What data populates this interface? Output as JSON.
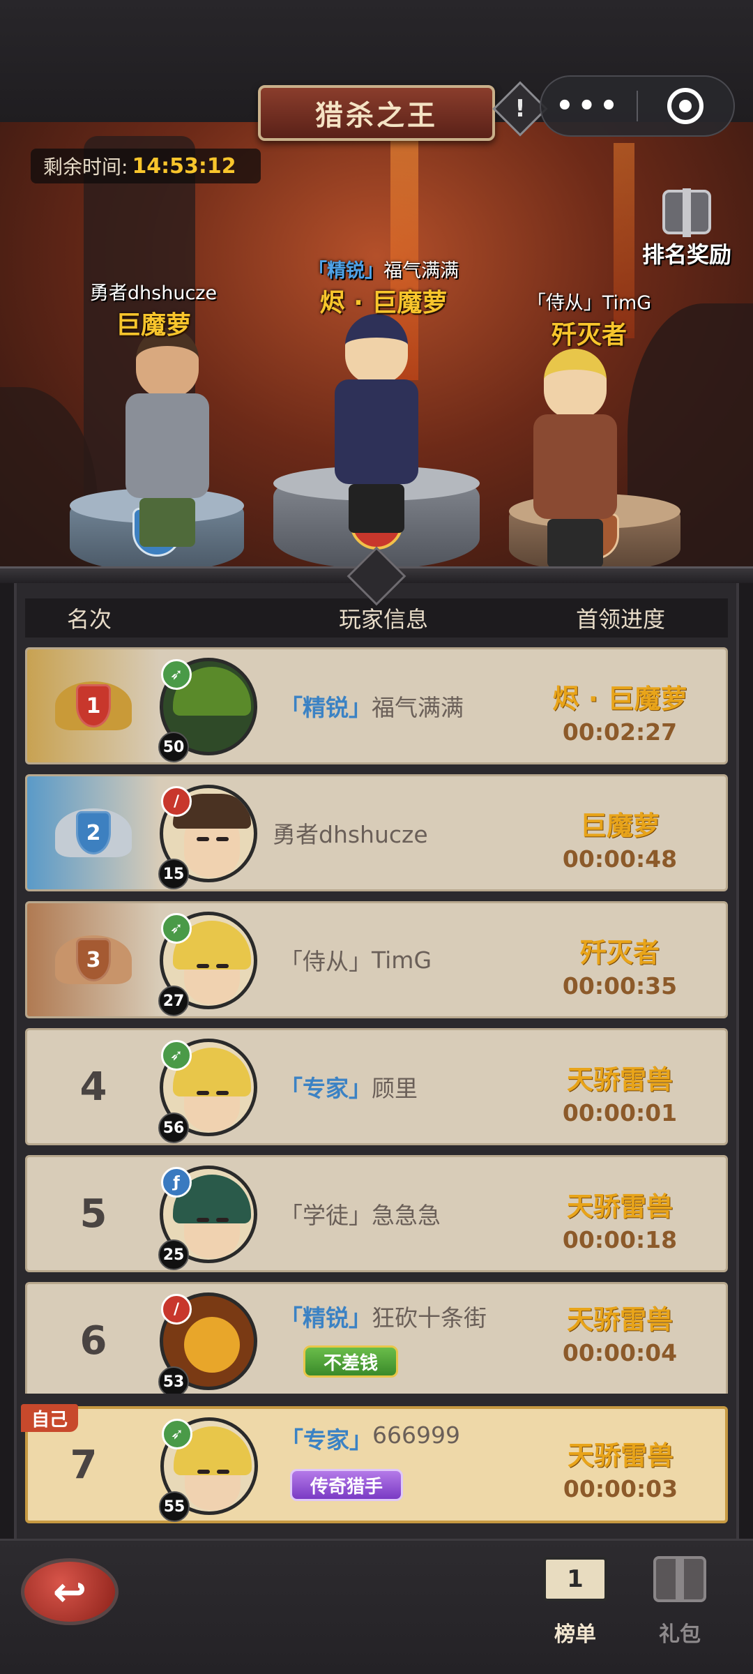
{
  "header": {
    "title": "猎杀之王",
    "info_icon": "exclamation-diamond-icon",
    "menu_dots": "•••"
  },
  "event": {
    "timer_label": "剩余时间:",
    "timer_value": "14:53:12",
    "reward_label": "排名奖励"
  },
  "podium": [
    {
      "rank": "1",
      "tag": "「精锐」",
      "player": "福气满满",
      "boss": "烬 · 巨魔萝"
    },
    {
      "rank": "2",
      "tag": "",
      "player": "勇者dhshucze",
      "boss": "巨魔萝"
    },
    {
      "rank": "3",
      "tag": "「侍从」",
      "player": "TimG",
      "boss": "歼灭者"
    }
  ],
  "table": {
    "col_rank": "名次",
    "col_player": "玩家信息",
    "col_progress": "首领进度"
  },
  "rows": [
    {
      "rank": "1",
      "class_icon": "green-bow-icon",
      "level": "50",
      "tag": "「精锐」",
      "name": "福气满满",
      "boss": "烬 · 巨魔萝",
      "time": "00:02:27"
    },
    {
      "rank": "2",
      "class_icon": "red-sword-icon",
      "level": "15",
      "tag": "",
      "name": "勇者dhshucze",
      "boss": "巨魔萝",
      "time": "00:00:48"
    },
    {
      "rank": "3",
      "class_icon": "green-bow-icon",
      "level": "27",
      "tag": "「侍从」",
      "name": "TimG",
      "boss": "歼灭者",
      "time": "00:00:35"
    },
    {
      "rank": "4",
      "class_icon": "green-bow-icon",
      "level": "56",
      "tag": "「专家」",
      "name": "顾里",
      "boss": "天骄雷兽",
      "time": "00:00:01"
    },
    {
      "rank": "5",
      "class_icon": "blue-staff-icon",
      "level": "25",
      "tag": "「学徒」",
      "name": "急急急",
      "boss": "天骄雷兽",
      "time": "00:00:18"
    },
    {
      "rank": "6",
      "class_icon": "red-sword-icon",
      "level": "53",
      "tag": "「精锐」",
      "name": "狂砍十条街",
      "title_badge": "不差钱",
      "boss": "天骄雷兽",
      "time": "00:00:04"
    }
  ],
  "self": {
    "tag_label": "自己",
    "rank": "7",
    "level": "55",
    "tag": "「专家」",
    "name": "666999",
    "title_badge": "传奇猎手",
    "boss": "天骄雷兽",
    "time": "00:00:03"
  },
  "nav": {
    "back_icon": "back-arrow-icon",
    "leaderboard_label": "榜单",
    "gift_label": "礼包"
  },
  "colors": {
    "gold": "#e8a41a",
    "time_brown": "#8c5a2a",
    "tag_blue": "#3b82c4",
    "row_bg": "#d8ccb8",
    "self_bg": "#eed8a8"
  }
}
